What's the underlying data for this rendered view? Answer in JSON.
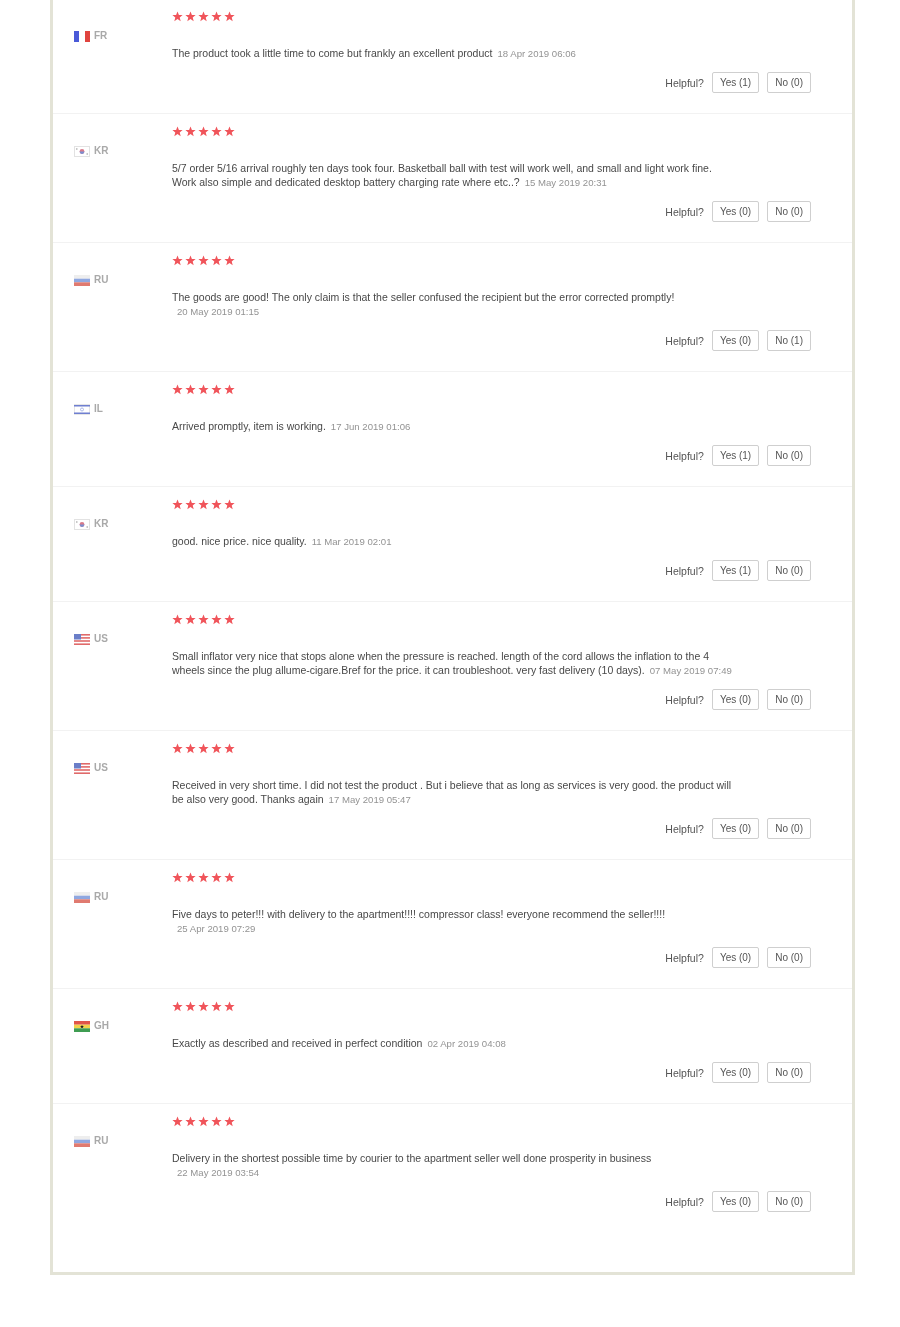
{
  "reviews": [
    {
      "country": "FR",
      "kind": "france",
      "stars": 5,
      "text": "The product took a little time to come but frankly an excellent product",
      "date": "18 Apr 2019 06:06",
      "helpful": "Helpful?",
      "yes": "Yes (1)",
      "no": "No (0)"
    },
    {
      "country": "KR",
      "kind": "korea",
      "stars": 5,
      "text": "5/7 order 5/16 arrival roughly ten days took four. Basketball ball with test will work well, and small and light work fine. Work also simple and dedicated desktop battery charging rate where etc..?",
      "date": "15 May 2019 20:31",
      "helpful": "Helpful?",
      "yes": "Yes (0)",
      "no": "No (0)"
    },
    {
      "country": "RU",
      "kind": "russia",
      "stars": 5,
      "text": "The goods are good! The only claim is that the seller confused the recipient but the error corrected promptly!",
      "date": "20 May 2019 01:15",
      "helpful": "Helpful?",
      "yes": "Yes (0)",
      "no": "No (1)"
    },
    {
      "country": "IL",
      "kind": "israel",
      "stars": 5,
      "text": "Arrived promptly, item is working.",
      "date": "17 Jun 2019 01:06",
      "helpful": "Helpful?",
      "yes": "Yes (1)",
      "no": "No (0)"
    },
    {
      "country": "KR",
      "kind": "korea",
      "stars": 5,
      "text": "good. nice price. nice quality.",
      "date": "11 Mar 2019 02:01",
      "helpful": "Helpful?",
      "yes": "Yes (1)",
      "no": "No (0)"
    },
    {
      "country": "US",
      "kind": "usa",
      "stars": 5,
      "text": "Small inflator very nice that stops alone when the pressure is reached. length of the cord allows the inflation to the 4 wheels since the plug allume-cigare.Bref for the price. it can troubleshoot. very fast delivery (10 days).",
      "date": "07 May 2019 07:49",
      "helpful": "Helpful?",
      "yes": "Yes (0)",
      "no": "No (0)"
    },
    {
      "country": "US",
      "kind": "usa",
      "stars": 5,
      "text": "Received in very short time. I did not test the product . But i believe that as long as services is very good. the product will be also very good. Thanks again",
      "date": "17 May 2019 05:47",
      "helpful": "Helpful?",
      "yes": "Yes (0)",
      "no": "No (0)"
    },
    {
      "country": "RU",
      "kind": "russia",
      "stars": 5,
      "text": "Five days to peter!!! with delivery to the apartment!!!! compressor class! everyone recommend the seller!!!!",
      "date": "25 Apr 2019 07:29",
      "helpful": "Helpful?",
      "yes": "Yes (0)",
      "no": "No (0)"
    },
    {
      "country": "GH",
      "kind": "ghana",
      "stars": 5,
      "text": "Exactly as described and received in perfect condition",
      "date": "02 Apr 2019 04:08",
      "helpful": "Helpful?",
      "yes": "Yes (0)",
      "no": "No (0)"
    },
    {
      "country": "RU",
      "kind": "russia",
      "stars": 5,
      "text": "Delivery in the shortest possible time by courier to the apartment seller well done prosperity in business",
      "date": "22 May 2019 03:54",
      "helpful": "Helpful?",
      "yes": "Yes (0)",
      "no": "No (0)"
    }
  ]
}
